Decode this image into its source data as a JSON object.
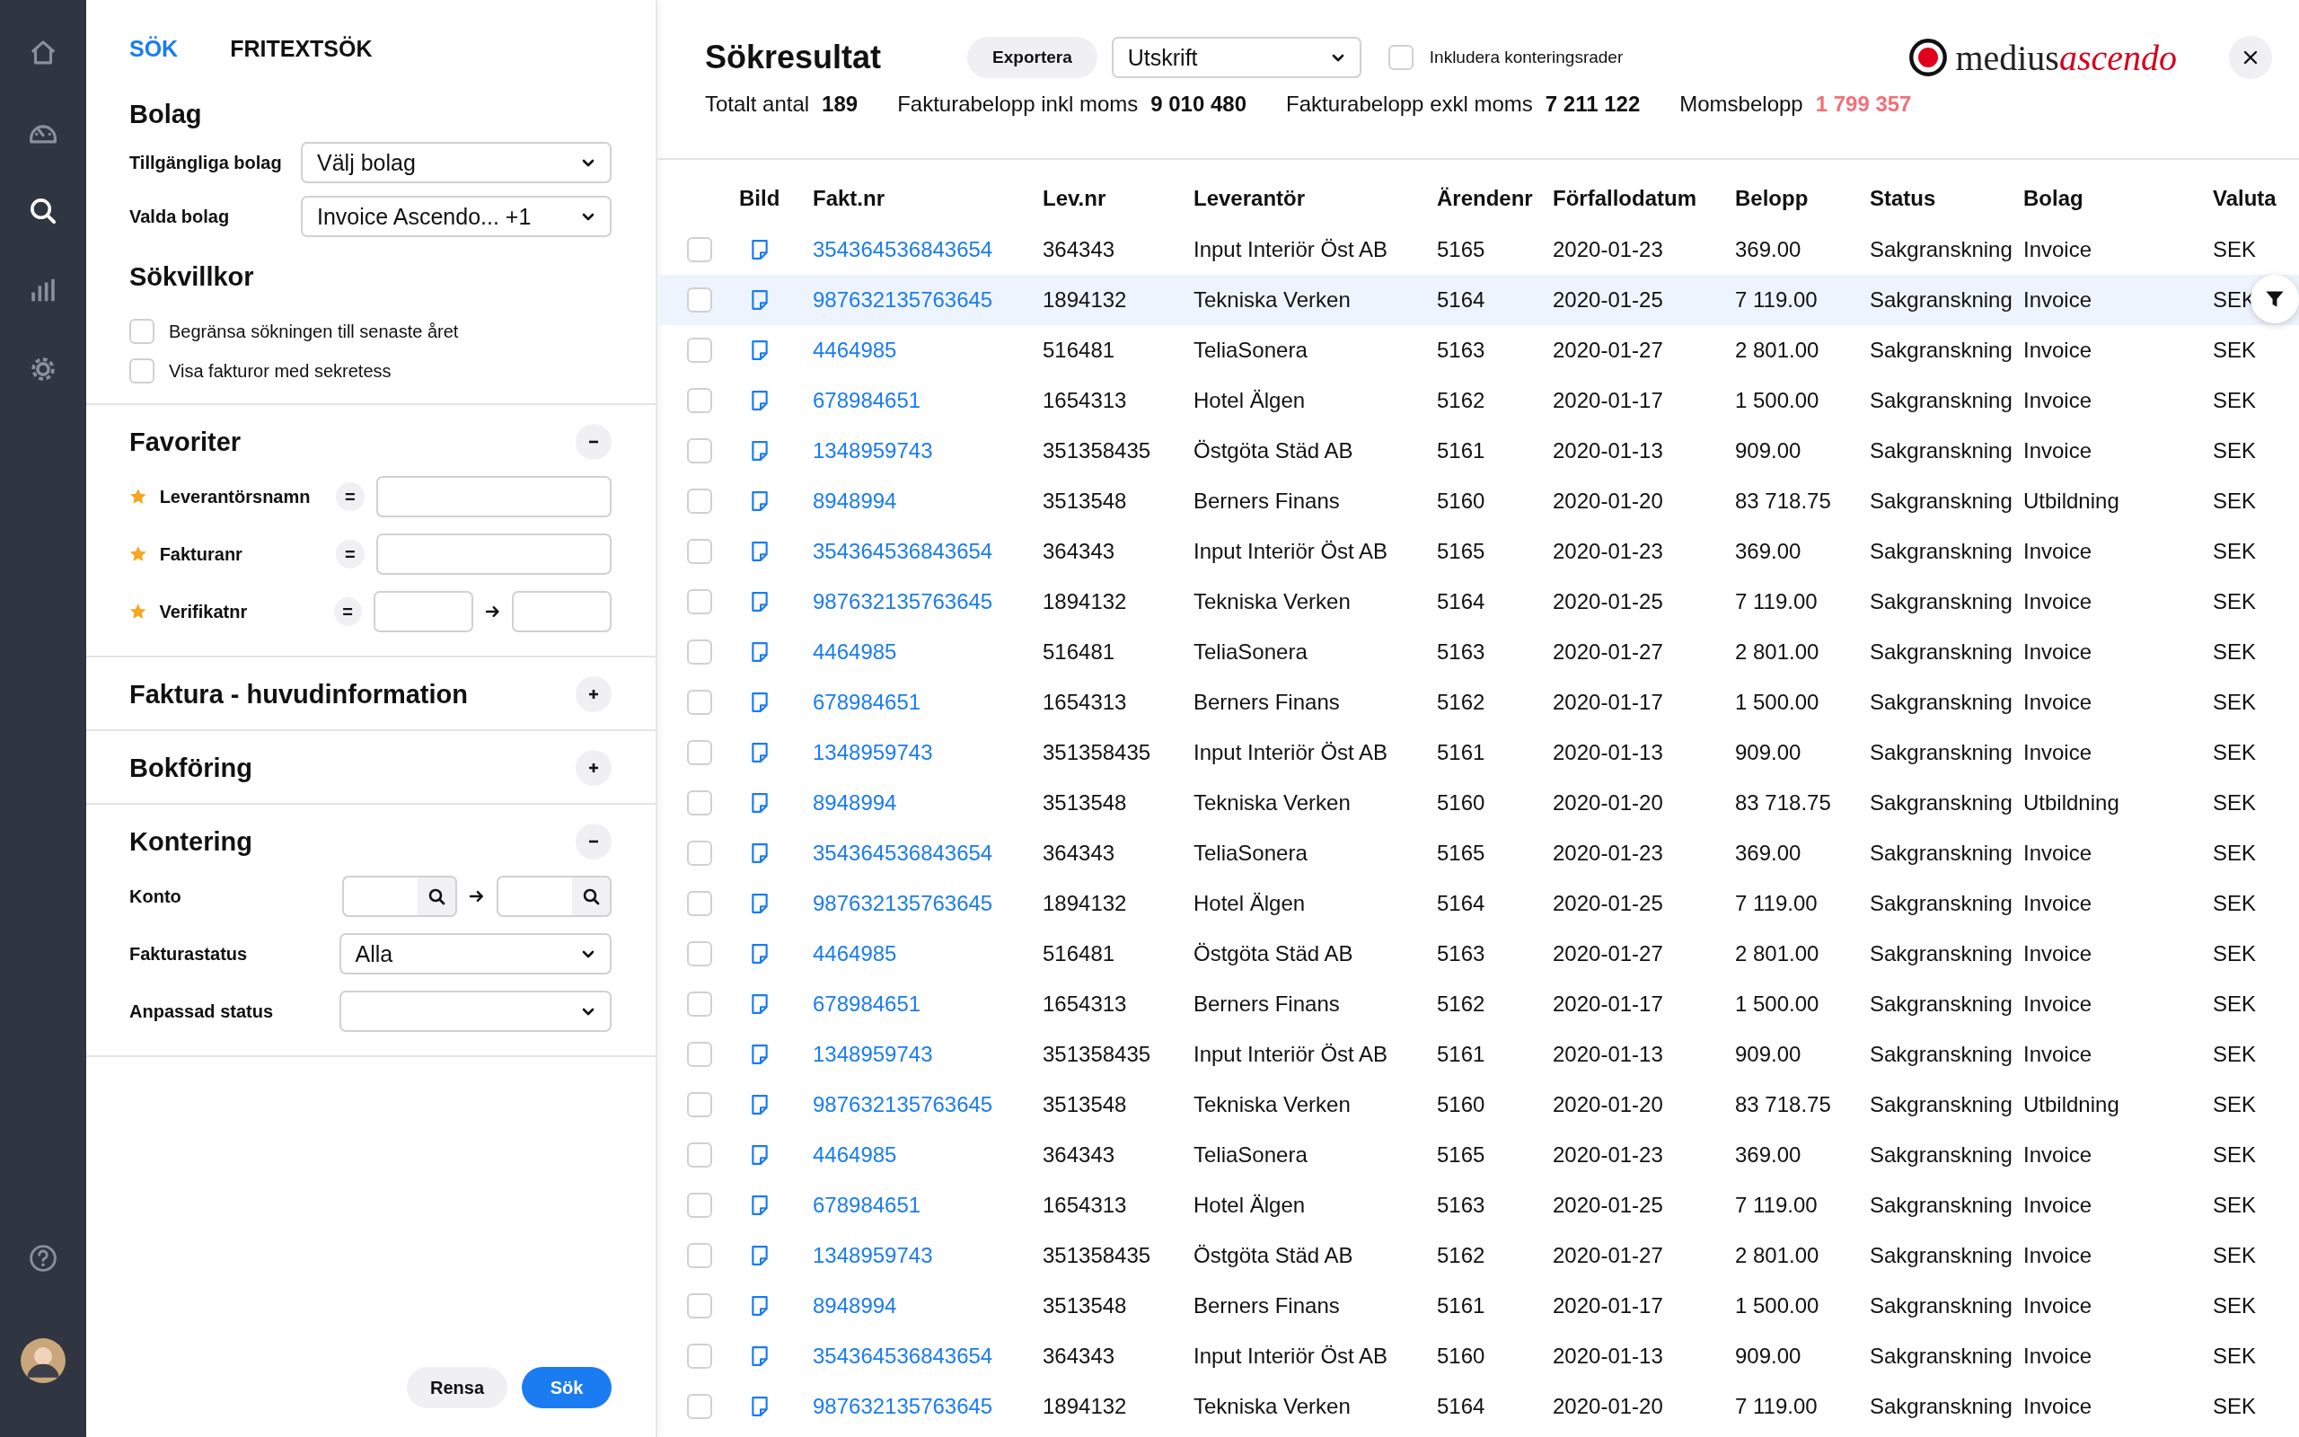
{
  "nav": {
    "items": [
      {
        "selected": false
      },
      {
        "selected": false
      },
      {
        "selected": true
      },
      {
        "selected": false
      },
      {
        "selected": false
      }
    ],
    "bottom": [
      {
        "kind": "help"
      },
      {
        "kind": "avatar"
      }
    ]
  },
  "search_panel": {
    "tabs": [
      {
        "label": "SÖK",
        "selected": true
      },
      {
        "label": "FRITEXTSÖK",
        "selected": false
      }
    ],
    "bolag": {
      "title": "Bolag",
      "fields": [
        {
          "label": "Tillgängliga bolag",
          "value": "Välj bolag"
        },
        {
          "label": "Valda bolag",
          "value": "Invoice Ascendo... +1"
        }
      ]
    },
    "sokvillkor": {
      "title": "Sökvillkor",
      "options": [
        {
          "label": "Begränsa sökningen till senaste året",
          "checked": false
        },
        {
          "label": "Visa fakturor med sekretess",
          "checked": false
        }
      ]
    },
    "sections": [
      {
        "title": "Favoriter",
        "expanded": true,
        "fields": [
          {
            "kind": "single",
            "label": "Leverantörsnamn",
            "operator": "="
          },
          {
            "kind": "single",
            "label": "Fakturanr",
            "operator": "="
          },
          {
            "kind": "range",
            "label": "Verifikatnr",
            "operator": "="
          }
        ]
      },
      {
        "title": "Faktura - huvudinformation",
        "expanded": false
      },
      {
        "title": "Bokföring",
        "expanded": false
      },
      {
        "title": "Kontering",
        "expanded": true,
        "fields": [
          {
            "kind": "search-range",
            "label": "Konto"
          },
          {
            "kind": "select",
            "label": "Fakturastatus",
            "value": "Alla"
          },
          {
            "kind": "select",
            "label": "Anpassad status"
          }
        ]
      }
    ],
    "buttons": [
      {
        "label": "Rensa",
        "kind": "secondary"
      },
      {
        "label": "Sök",
        "kind": "primary"
      }
    ]
  },
  "results": {
    "title": "Sökresultat",
    "export_button": "Exportera",
    "format": "Utskrift",
    "include_option": {
      "label": "Inkludera konteringsrader",
      "checked": false
    },
    "logo": {
      "name": "medius",
      "accent": "ascendo"
    },
    "stats": [
      {
        "label": "Totalt antal",
        "value": "189",
        "highlight": false
      },
      {
        "label": "Fakturabelopp inkl moms",
        "value": "9 010 480",
        "highlight": false
      },
      {
        "label": "Fakturabelopp exkl moms",
        "value": "7 211 122",
        "highlight": false
      },
      {
        "label": "Momsbelopp",
        "value": "1 799 357",
        "highlight": true
      }
    ],
    "table": {
      "columns": [
        "Bild",
        "Fakt.nr",
        "Lev.nr",
        "Leverantör",
        "Ärendenr",
        "Förfallodatum",
        "Belopp",
        "Status",
        "Bolag",
        "Valuta"
      ],
      "rows": [
        {
          "checked": false,
          "highlighted": false,
          "cells": [
            "",
            "354364536843654",
            "364343",
            "Input Interiör Öst AB",
            "5165",
            "2020-01-23",
            "369.00",
            "Sakgranskning",
            "Invoice",
            "SEK"
          ]
        },
        {
          "checked": false,
          "highlighted": true,
          "cells": [
            "",
            "987632135763645",
            "1894132",
            "Tekniska Verken",
            "5164",
            "2020-01-25",
            "7 119.00",
            "Sakgranskning",
            "Invoice",
            "SEK"
          ]
        },
        {
          "checked": false,
          "highlighted": false,
          "cells": [
            "",
            "4464985",
            "516481",
            "TeliaSonera",
            "5163",
            "2020-01-27",
            "2 801.00",
            "Sakgranskning",
            "Invoice",
            "SEK"
          ]
        },
        {
          "checked": false,
          "highlighted": false,
          "cells": [
            "",
            "678984651",
            "1654313",
            "Hotel Älgen",
            "5162",
            "2020-01-17",
            "1 500.00",
            "Sakgranskning",
            "Invoice",
            "SEK"
          ]
        },
        {
          "checked": false,
          "highlighted": false,
          "cells": [
            "",
            "1348959743",
            "351358435",
            "Östgöta Städ AB",
            "5161",
            "2020-01-13",
            "909.00",
            "Sakgranskning",
            "Invoice",
            "SEK"
          ]
        },
        {
          "checked": false,
          "highlighted": false,
          "cells": [
            "",
            "8948994",
            "3513548",
            "Berners Finans",
            "5160",
            "2020-01-20",
            "83 718.75",
            "Sakgranskning",
            "Utbildning",
            "SEK"
          ]
        },
        {
          "checked": false,
          "highlighted": false,
          "cells": [
            "",
            "354364536843654",
            "364343",
            "Input Interiör Öst AB",
            "5165",
            "2020-01-23",
            "369.00",
            "Sakgranskning",
            "Invoice",
            "SEK"
          ]
        },
        {
          "checked": false,
          "highlighted": false,
          "cells": [
            "",
            "987632135763645",
            "1894132",
            "Tekniska Verken",
            "5164",
            "2020-01-25",
            "7 119.00",
            "Sakgranskning",
            "Invoice",
            "SEK"
          ]
        },
        {
          "checked": false,
          "highlighted": false,
          "cells": [
            "",
            "4464985",
            "516481",
            "TeliaSonera",
            "5163",
            "2020-01-27",
            "2 801.00",
            "Sakgranskning",
            "Invoice",
            "SEK"
          ]
        },
        {
          "checked": false,
          "highlighted": false,
          "cells": [
            "",
            "678984651",
            "1654313",
            "Berners Finans",
            "5162",
            "2020-01-17",
            "1 500.00",
            "Sakgranskning",
            "Invoice",
            "SEK"
          ]
        },
        {
          "checked": false,
          "highlighted": false,
          "cells": [
            "",
            "1348959743",
            "351358435",
            "Input Interiör Öst AB",
            "5161",
            "2020-01-13",
            "909.00",
            "Sakgranskning",
            "Invoice",
            "SEK"
          ]
        },
        {
          "checked": false,
          "highlighted": false,
          "cells": [
            "",
            "8948994",
            "3513548",
            "Tekniska Verken",
            "5160",
            "2020-01-20",
            "83 718.75",
            "Sakgranskning",
            "Utbildning",
            "SEK"
          ]
        },
        {
          "checked": false,
          "highlighted": false,
          "cells": [
            "",
            "354364536843654",
            "364343",
            "TeliaSonera",
            "5165",
            "2020-01-23",
            "369.00",
            "Sakgranskning",
            "Invoice",
            "SEK"
          ]
        },
        {
          "checked": false,
          "highlighted": false,
          "cells": [
            "",
            "987632135763645",
            "1894132",
            "Hotel Älgen",
            "5164",
            "2020-01-25",
            "7 119.00",
            "Sakgranskning",
            "Invoice",
            "SEK"
          ]
        },
        {
          "checked": false,
          "highlighted": false,
          "cells": [
            "",
            "4464985",
            "516481",
            "Östgöta Städ AB",
            "5163",
            "2020-01-27",
            "2 801.00",
            "Sakgranskning",
            "Invoice",
            "SEK"
          ]
        },
        {
          "checked": false,
          "highlighted": false,
          "cells": [
            "",
            "678984651",
            "1654313",
            "Berners Finans",
            "5162",
            "2020-01-17",
            "1 500.00",
            "Sakgranskning",
            "Invoice",
            "SEK"
          ]
        },
        {
          "checked": false,
          "highlighted": false,
          "cells": [
            "",
            "1348959743",
            "351358435",
            "Input Interiör Öst AB",
            "5161",
            "2020-01-13",
            "909.00",
            "Sakgranskning",
            "Invoice",
            "SEK"
          ]
        },
        {
          "checked": false,
          "highlighted": false,
          "cells": [
            "",
            "987632135763645",
            "3513548",
            "Tekniska Verken",
            "5160",
            "2020-01-20",
            "83 718.75",
            "Sakgranskning",
            "Utbildning",
            "SEK"
          ]
        },
        {
          "checked": false,
          "highlighted": false,
          "cells": [
            "",
            "4464985",
            "364343",
            "TeliaSonera",
            "5165",
            "2020-01-23",
            "369.00",
            "Sakgranskning",
            "Invoice",
            "SEK"
          ]
        },
        {
          "checked": false,
          "highlighted": false,
          "cells": [
            "",
            "678984651",
            "1654313",
            "Hotel Älgen",
            "5163",
            "2020-01-25",
            "7 119.00",
            "Sakgranskning",
            "Invoice",
            "SEK"
          ]
        },
        {
          "checked": false,
          "highlighted": false,
          "cells": [
            "",
            "1348959743",
            "351358435",
            "Östgöta Städ AB",
            "5162",
            "2020-01-27",
            "2 801.00",
            "Sakgranskning",
            "Invoice",
            "SEK"
          ]
        },
        {
          "checked": false,
          "highlighted": false,
          "cells": [
            "",
            "8948994",
            "3513548",
            "Berners Finans",
            "5161",
            "2020-01-17",
            "1 500.00",
            "Sakgranskning",
            "Invoice",
            "SEK"
          ]
        },
        {
          "checked": false,
          "highlighted": false,
          "cells": [
            "",
            "354364536843654",
            "364343",
            "Input Interiör Öst AB",
            "5160",
            "2020-01-13",
            "909.00",
            "Sakgranskning",
            "Invoice",
            "SEK"
          ]
        },
        {
          "checked": false,
          "highlighted": false,
          "cells": [
            "",
            "987632135763645",
            "1894132",
            "Tekniska Verken",
            "5164",
            "2020-01-20",
            "7 119.00",
            "Sakgranskning",
            "Invoice",
            "SEK"
          ]
        }
      ]
    }
  }
}
